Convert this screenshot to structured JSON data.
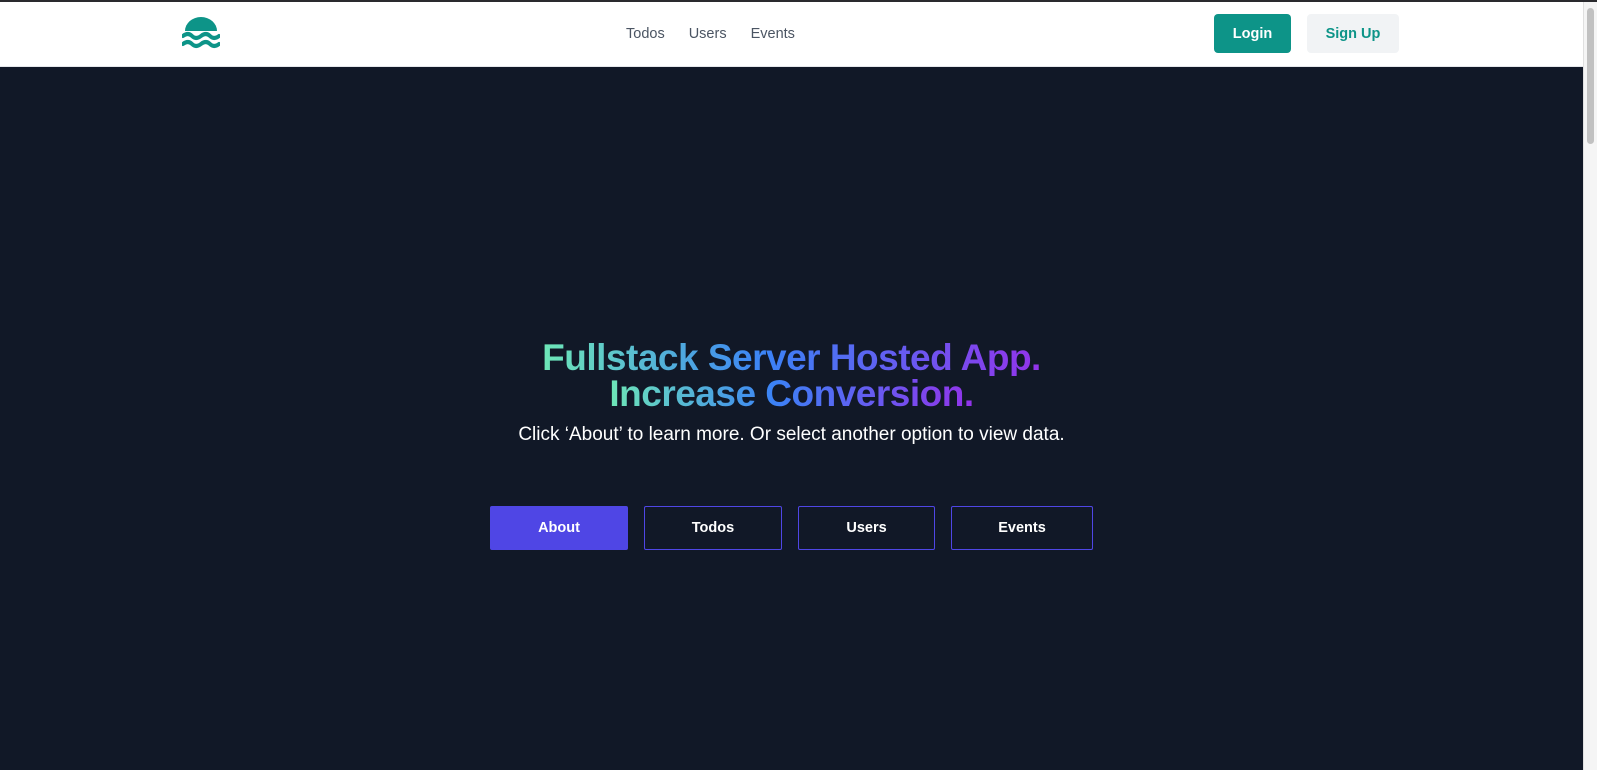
{
  "header": {
    "logo": "waves-logo-icon",
    "nav": [
      {
        "label": "Todos"
      },
      {
        "label": "Users"
      },
      {
        "label": "Events"
      }
    ],
    "login_label": "Login",
    "signup_label": "Sign Up"
  },
  "hero": {
    "headline_line1": "Fullstack Server Hosted App.",
    "headline_line2": "Increase Conversion.",
    "subtitle": "Click ‘About’ to learn more. Or select another option to view data.",
    "buttons": [
      {
        "label": "About"
      },
      {
        "label": "Todos"
      },
      {
        "label": "Users"
      },
      {
        "label": "Events"
      }
    ]
  },
  "colors": {
    "accent": "#0d9488",
    "primary": "#4f46e5",
    "background": "#111827"
  }
}
